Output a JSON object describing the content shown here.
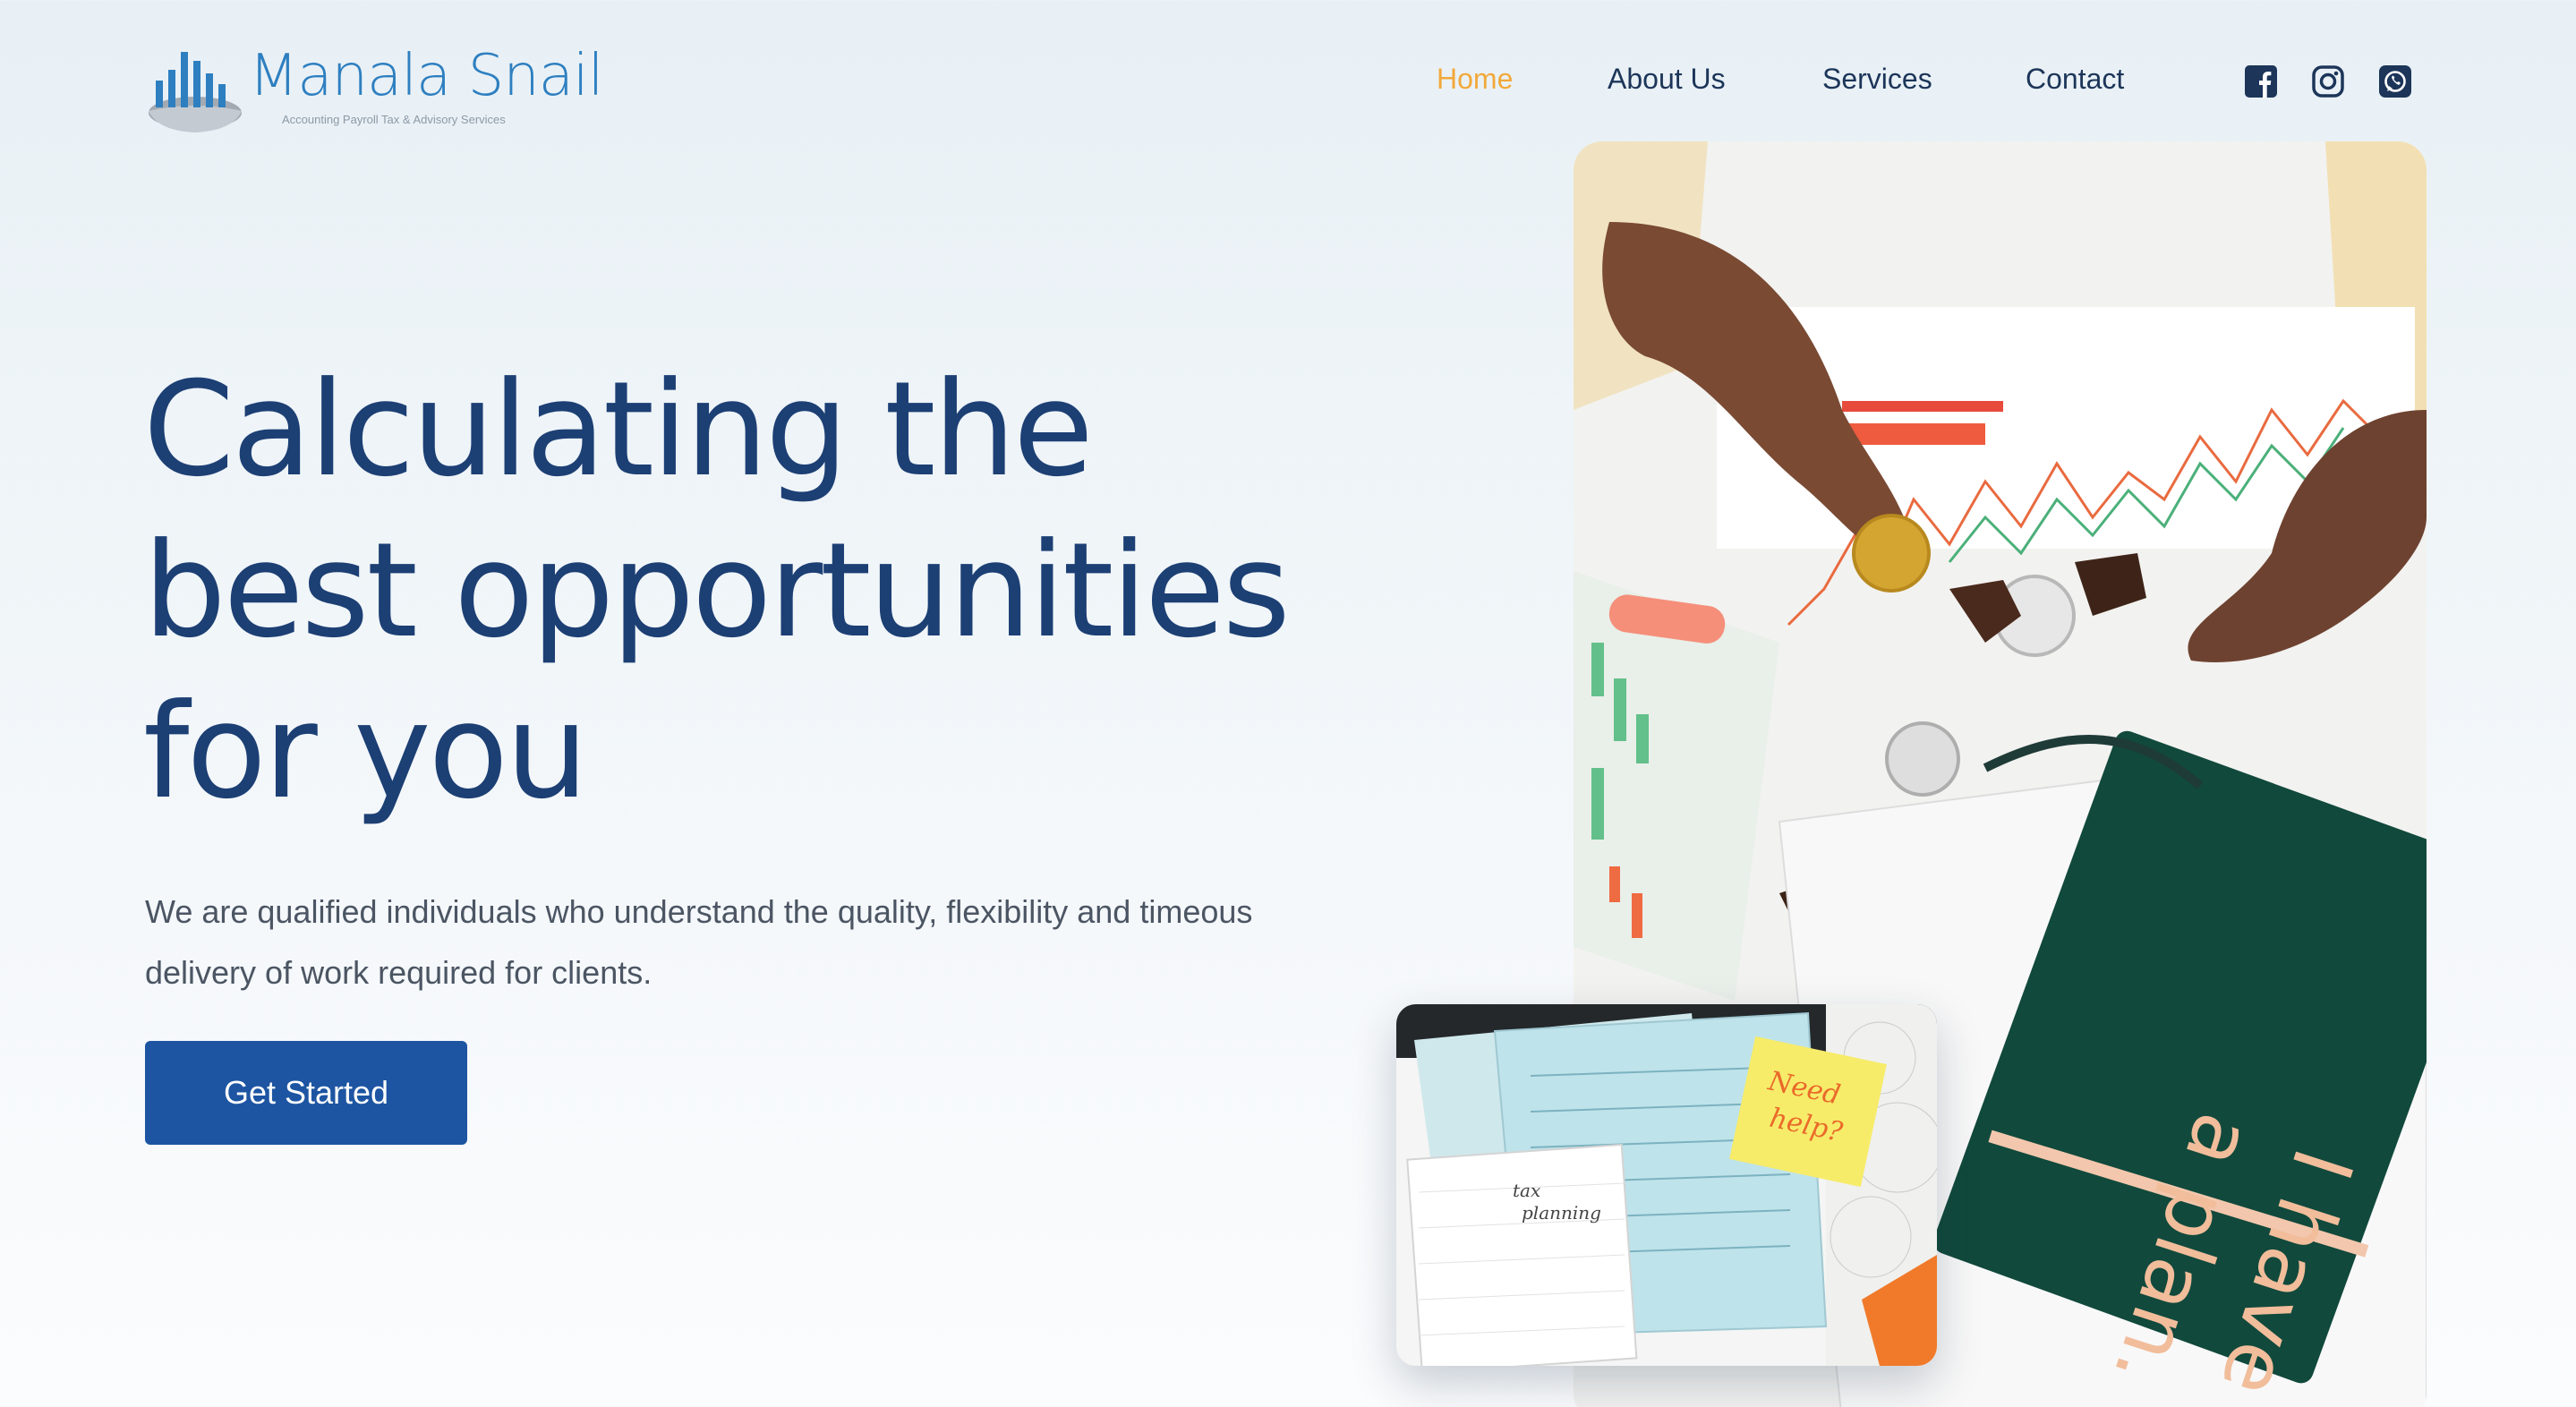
{
  "brand": {
    "name": "Manala Snail",
    "tagline": "Accounting Payroll Tax & Advisory Services",
    "colors": {
      "primary": "#1c3f74",
      "accent": "#f2a93b",
      "button": "#1d55a2",
      "logo": "#2e7fc0"
    }
  },
  "nav": {
    "items": [
      {
        "label": "Home",
        "active": true
      },
      {
        "label": "About Us",
        "active": false
      },
      {
        "label": "Services",
        "active": false
      },
      {
        "label": "Contact",
        "active": false
      }
    ]
  },
  "social": {
    "icons": [
      "facebook-icon",
      "instagram-icon",
      "whatsapp-icon"
    ]
  },
  "hero": {
    "title_lines": [
      "Calculating the",
      "best opportunities",
      "for you"
    ],
    "subtitle": "We are qualified individuals who understand the quality, flexibility and timeous delivery of work required for clients.",
    "cta_label": "Get Started"
  },
  "images": {
    "main_photo_notebook_text": [
      "I have",
      "a plan."
    ],
    "small_photo_note_text": [
      "Need",
      "help?"
    ],
    "small_photo_notepad_text": [
      "tax",
      "planning"
    ]
  }
}
